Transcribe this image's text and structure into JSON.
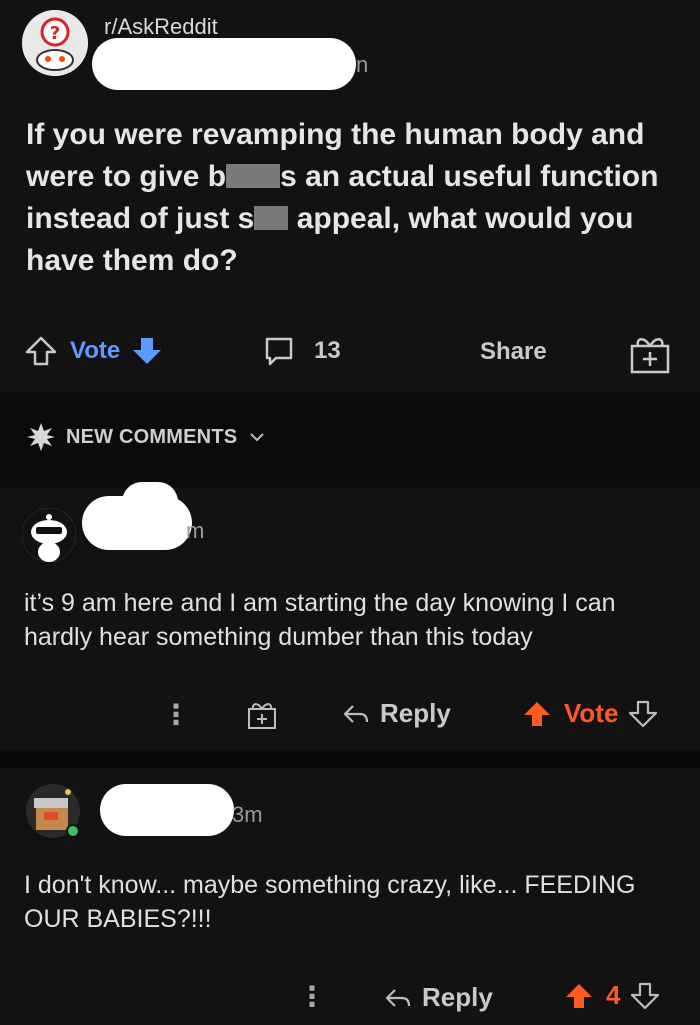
{
  "post": {
    "subreddit": "r/AskReddit",
    "time_fragment": "n",
    "title_parts": {
      "a": "If you were revamping the human body and were to give b",
      "b": "s an actual useful function instead of just s",
      "c": " appeal, what would you have them do?"
    },
    "vote_label": "Vote",
    "comment_count": "13",
    "share_label": "Share"
  },
  "new_comments": {
    "label": "NEW COMMENTS"
  },
  "comments": [
    {
      "time": "m",
      "text": "it’s 9 am here and I am starting the day knowing I can hardly hear something dumber than this today",
      "more": "⋮",
      "reply_label": "Reply",
      "vote_label": "Vote"
    },
    {
      "time": "3m",
      "text": "I don't know... maybe something crazy, like... FEEDING OUR BABIES?!!!",
      "more": "⋮",
      "reply_label": "Reply",
      "score": "4"
    }
  ],
  "colors": {
    "background": "#121212",
    "upvote_orange": "#ff5a1f",
    "downvote_blue": "#5d9bff",
    "text": "#e0e0e0"
  }
}
